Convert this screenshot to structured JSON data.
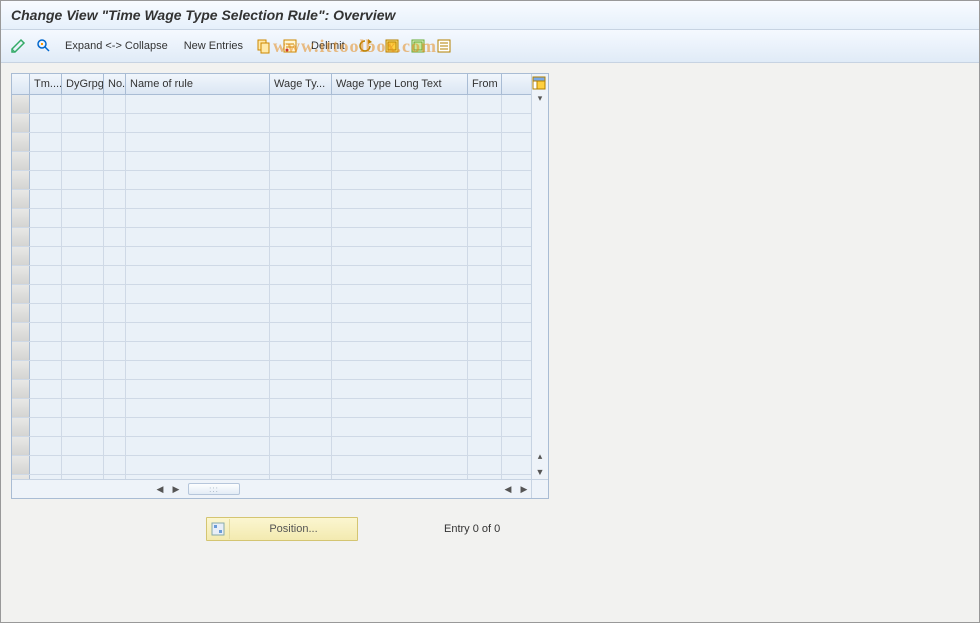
{
  "title": "Change View \"Time Wage Type Selection Rule\": Overview",
  "toolbar": {
    "expand_collapse": "Expand <-> Collapse",
    "new_entries": "New Entries",
    "delimit": "Delimit"
  },
  "watermark": "www.ittoolbox.com",
  "table": {
    "columns": [
      "Tm....",
      "DyGrpg",
      "No.",
      "Name of rule",
      "Wage Ty...",
      "Wage Type Long Text",
      "From"
    ],
    "rows": []
  },
  "footer": {
    "position_button": "Position...",
    "entry_text": "Entry 0 of 0"
  }
}
